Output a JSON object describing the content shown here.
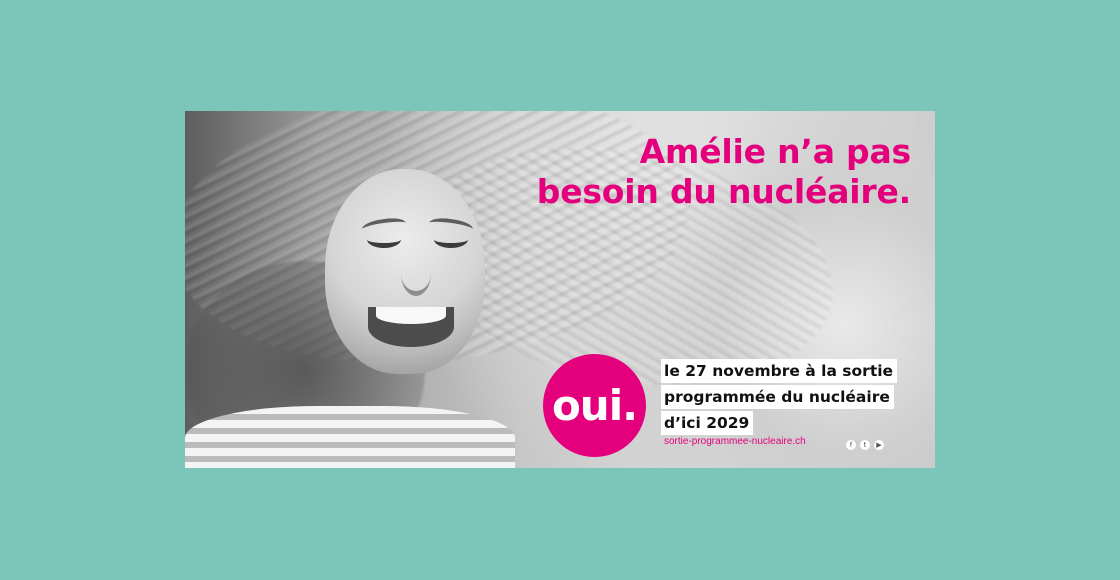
{
  "poster": {
    "headline_line1": "Amélie n’a pas",
    "headline_line2": "besoin du nucléaire.",
    "badge_text": "oui.",
    "info_lines": [
      "le 27 novembre à la sortie",
      "programmée du nucléaire",
      "d’ici 2029"
    ],
    "url": "sortie-programmee-nucleaire.ch",
    "social_icons": [
      "facebook-icon",
      "twitter-icon",
      "youtube-icon"
    ],
    "accent_color": "#e4007c",
    "background_color": "#7cc6b9"
  }
}
